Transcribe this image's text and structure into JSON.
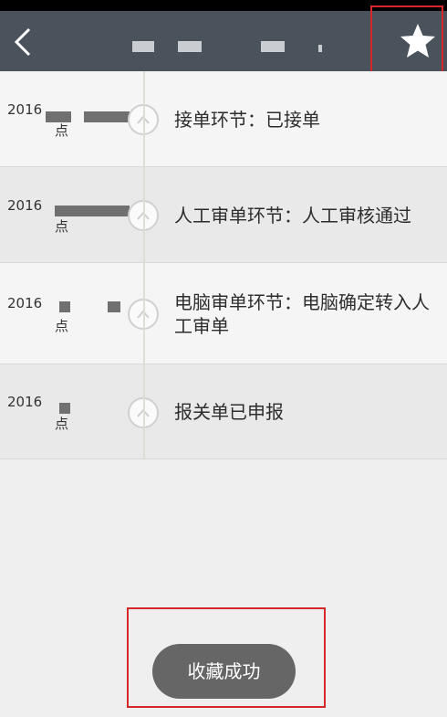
{
  "header": {
    "back_icon": "chevron-left-icon",
    "favorite_icon": "star-icon"
  },
  "timeline": {
    "items": [
      {
        "date": "2016",
        "unit": "点",
        "status": "接单环节：已接单"
      },
      {
        "date": "2016",
        "unit": "点",
        "status": "人工审单环节：人工审核通过"
      },
      {
        "date": "2016",
        "unit": "点",
        "status": "电脑审单环节：电脑确定转入人工审单"
      },
      {
        "date": "2016",
        "unit": "点",
        "status": "报关单已申报"
      }
    ]
  },
  "toast": {
    "message": "收藏成功"
  },
  "colors": {
    "header_bg": "#4a535b",
    "highlight": "#d6262a",
    "toast_bg": "#666666"
  }
}
